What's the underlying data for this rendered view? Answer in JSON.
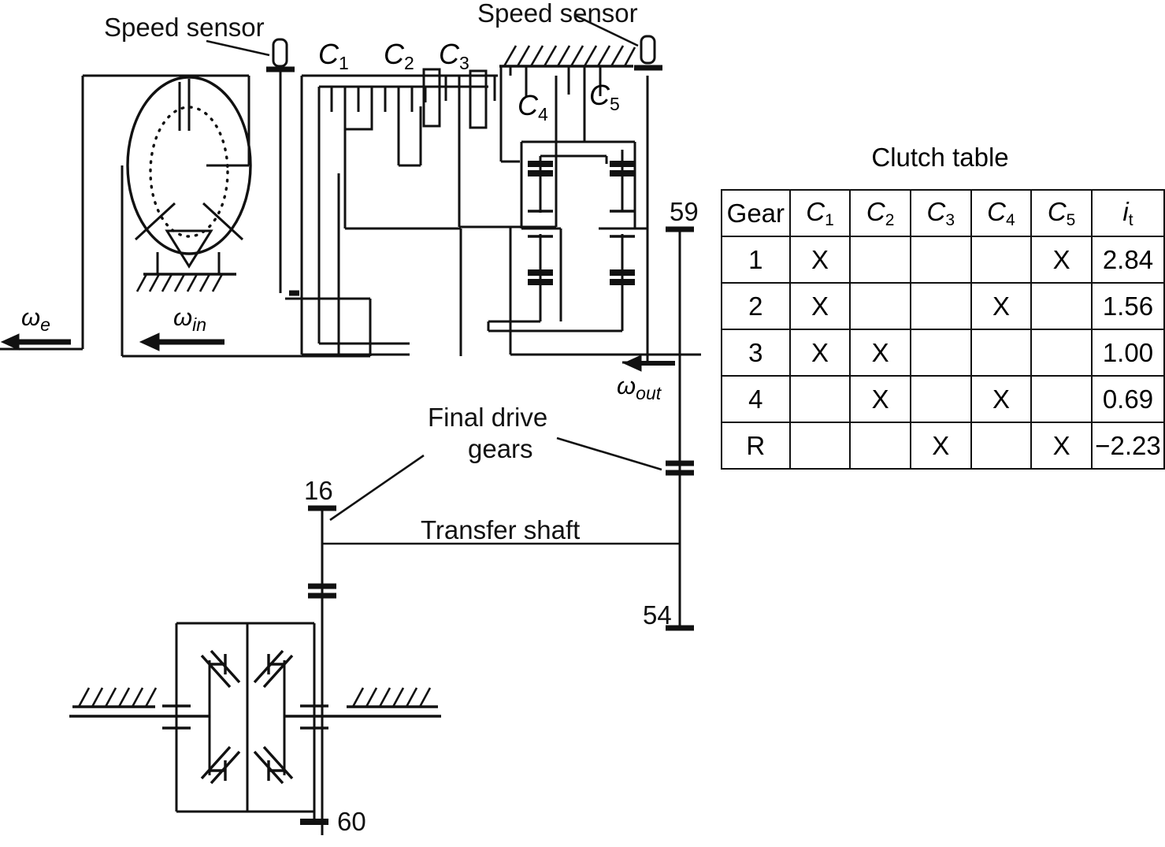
{
  "diagram": {
    "title_hidden": "",
    "annotations": {
      "speed_sensor_left": "Speed sensor",
      "speed_sensor_right": "Speed sensor",
      "final_drive_gears_line1": "Final drive",
      "final_drive_gears_line2": "gears",
      "transfer_shaft": "Transfer shaft"
    },
    "clutch_labels": {
      "c1": "C",
      "c1sub": "1",
      "c2": "C",
      "c2sub": "2",
      "c3": "C",
      "c3sub": "3",
      "c4": "C",
      "c4sub": "4",
      "c5": "C",
      "c5sub": "5"
    },
    "speed_labels": {
      "omega_e": "ω",
      "omega_e_sub": "e",
      "omega_in": "ω",
      "omega_in_sub": "in",
      "omega_out": "ω",
      "omega_out_sub": "out"
    },
    "node_numbers": {
      "n59": "59",
      "n16": "16",
      "n54": "54",
      "n60": "60"
    }
  },
  "clutch_table": {
    "title": "Clutch table",
    "headers": [
      "Gear",
      "C1",
      "C2",
      "C3",
      "C4",
      "C5",
      "it"
    ],
    "header_display": [
      {
        "text": "Gear",
        "italic": false,
        "sub": ""
      },
      {
        "text": "C",
        "italic": true,
        "sub": "1"
      },
      {
        "text": "C",
        "italic": true,
        "sub": "2"
      },
      {
        "text": "C",
        "italic": true,
        "sub": "3"
      },
      {
        "text": "C",
        "italic": true,
        "sub": "4"
      },
      {
        "text": "C",
        "italic": true,
        "sub": "5"
      },
      {
        "text": "i",
        "italic": true,
        "sub": "t"
      }
    ],
    "mark": "X",
    "rows": [
      {
        "gear": "1",
        "c1": "X",
        "c2": "",
        "c3": "",
        "c4": "",
        "c5": "X",
        "ratio": "2.84"
      },
      {
        "gear": "2",
        "c1": "X",
        "c2": "",
        "c3": "",
        "c4": "X",
        "c5": "",
        "ratio": "1.56"
      },
      {
        "gear": "3",
        "c1": "X",
        "c2": "X",
        "c3": "",
        "c4": "",
        "c5": "",
        "ratio": "1.00"
      },
      {
        "gear": "4",
        "c1": "",
        "c2": "X",
        "c3": "",
        "c4": "X",
        "c5": "",
        "ratio": "0.69"
      },
      {
        "gear": "R",
        "c1": "",
        "c2": "",
        "c3": "X",
        "c4": "",
        "c5": "X",
        "ratio": "−2.23"
      }
    ]
  },
  "colors": {
    "line": "#111111",
    "background": "#ffffff"
  }
}
